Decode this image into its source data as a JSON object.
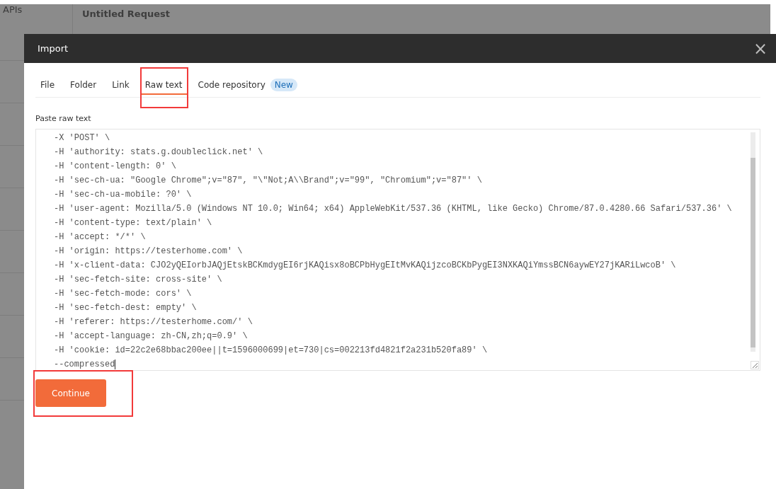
{
  "background": {
    "sidebar": {
      "items": [
        "APIs"
      ]
    },
    "request_title": "Untitled Request"
  },
  "dialog": {
    "title": "Import",
    "close": "×",
    "tabs": [
      {
        "label": "File",
        "selected": false,
        "highlighted": false
      },
      {
        "label": "Folder",
        "selected": false,
        "highlighted": false
      },
      {
        "label": "Link",
        "selected": false,
        "highlighted": false
      },
      {
        "label": "Raw text",
        "selected": true,
        "highlighted": true
      },
      {
        "label": "Code repository",
        "selected": false,
        "highlighted": false,
        "badge": "New"
      }
    ],
    "field_label": "Paste raw text",
    "raw_text": [
      "-X 'POST' \\",
      "-H 'authority: stats.g.doubleclick.net' \\",
      "-H 'content-length: 0' \\",
      "-H 'sec-ch-ua: \"Google Chrome\";v=\"87\", \"\\\"Not;A\\\\Brand\";v=\"99\", \"Chromium\";v=\"87\"' \\",
      "-H 'sec-ch-ua-mobile: ?0' \\",
      "-H 'user-agent: Mozilla/5.0 (Windows NT 10.0; Win64; x64) AppleWebKit/537.36 (KHTML, like Gecko) Chrome/87.0.4280.66 Safari/537.36' \\",
      "-H 'content-type: text/plain' \\",
      "-H 'accept: */*' \\",
      "-H 'origin: https://testerhome.com' \\",
      "-H 'x-client-data: CJO2yQEIorbJAQjEtskBCKmdygEI6rjKAQisx8oBCPbHygEItMvKAQijzcoBCKbPygEI3NXKAQiYmssBCN6aywEY27jKARiLwcoB' \\",
      "-H 'sec-fetch-site: cross-site' \\",
      "-H 'sec-fetch-mode: cors' \\",
      "-H 'sec-fetch-dest: empty' \\",
      "-H 'referer: https://testerhome.com/' \\",
      "-H 'accept-language: zh-CN,zh;q=0.9' \\",
      "-H 'cookie: id=22c2e68bbac200ee||t=1596000699|et=730|cs=002213fd4821f2a231b520fa89' \\",
      "--compressed"
    ],
    "continue_button": {
      "label": "Continue",
      "highlighted": true
    }
  }
}
